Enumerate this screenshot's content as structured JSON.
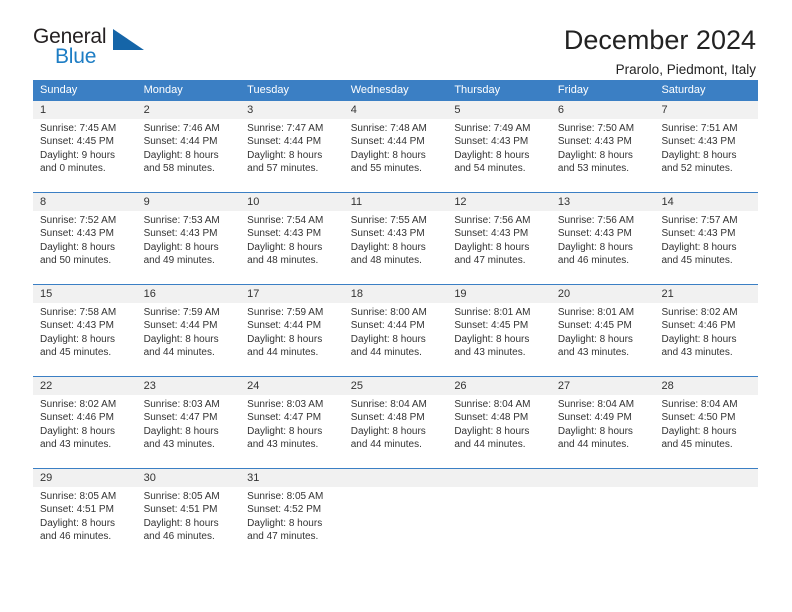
{
  "brand": {
    "name_part1": "General",
    "name_part2": "Blue",
    "triangle_color": "#1565a8",
    "blue_text_color": "#1d7dc4"
  },
  "header": {
    "title": "December 2024",
    "subtitle": "Prarolo, Piedmont, Italy"
  },
  "theme": {
    "header_blue": "#3b7fc4",
    "date_band": "#f1f1f1",
    "text": "#333333"
  },
  "weekdays": [
    "Sunday",
    "Monday",
    "Tuesday",
    "Wednesday",
    "Thursday",
    "Friday",
    "Saturday"
  ],
  "weeks": [
    {
      "days": [
        {
          "date": "1",
          "sunrise": "Sunrise: 7:45 AM",
          "sunset": "Sunset: 4:45 PM",
          "daylight1": "Daylight: 9 hours",
          "daylight2": "and 0 minutes."
        },
        {
          "date": "2",
          "sunrise": "Sunrise: 7:46 AM",
          "sunset": "Sunset: 4:44 PM",
          "daylight1": "Daylight: 8 hours",
          "daylight2": "and 58 minutes."
        },
        {
          "date": "3",
          "sunrise": "Sunrise: 7:47 AM",
          "sunset": "Sunset: 4:44 PM",
          "daylight1": "Daylight: 8 hours",
          "daylight2": "and 57 minutes."
        },
        {
          "date": "4",
          "sunrise": "Sunrise: 7:48 AM",
          "sunset": "Sunset: 4:44 PM",
          "daylight1": "Daylight: 8 hours",
          "daylight2": "and 55 minutes."
        },
        {
          "date": "5",
          "sunrise": "Sunrise: 7:49 AM",
          "sunset": "Sunset: 4:43 PM",
          "daylight1": "Daylight: 8 hours",
          "daylight2": "and 54 minutes."
        },
        {
          "date": "6",
          "sunrise": "Sunrise: 7:50 AM",
          "sunset": "Sunset: 4:43 PM",
          "daylight1": "Daylight: 8 hours",
          "daylight2": "and 53 minutes."
        },
        {
          "date": "7",
          "sunrise": "Sunrise: 7:51 AM",
          "sunset": "Sunset: 4:43 PM",
          "daylight1": "Daylight: 8 hours",
          "daylight2": "and 52 minutes."
        }
      ]
    },
    {
      "days": [
        {
          "date": "8",
          "sunrise": "Sunrise: 7:52 AM",
          "sunset": "Sunset: 4:43 PM",
          "daylight1": "Daylight: 8 hours",
          "daylight2": "and 50 minutes."
        },
        {
          "date": "9",
          "sunrise": "Sunrise: 7:53 AM",
          "sunset": "Sunset: 4:43 PM",
          "daylight1": "Daylight: 8 hours",
          "daylight2": "and 49 minutes."
        },
        {
          "date": "10",
          "sunrise": "Sunrise: 7:54 AM",
          "sunset": "Sunset: 4:43 PM",
          "daylight1": "Daylight: 8 hours",
          "daylight2": "and 48 minutes."
        },
        {
          "date": "11",
          "sunrise": "Sunrise: 7:55 AM",
          "sunset": "Sunset: 4:43 PM",
          "daylight1": "Daylight: 8 hours",
          "daylight2": "and 48 minutes."
        },
        {
          "date": "12",
          "sunrise": "Sunrise: 7:56 AM",
          "sunset": "Sunset: 4:43 PM",
          "daylight1": "Daylight: 8 hours",
          "daylight2": "and 47 minutes."
        },
        {
          "date": "13",
          "sunrise": "Sunrise: 7:56 AM",
          "sunset": "Sunset: 4:43 PM",
          "daylight1": "Daylight: 8 hours",
          "daylight2": "and 46 minutes."
        },
        {
          "date": "14",
          "sunrise": "Sunrise: 7:57 AM",
          "sunset": "Sunset: 4:43 PM",
          "daylight1": "Daylight: 8 hours",
          "daylight2": "and 45 minutes."
        }
      ]
    },
    {
      "days": [
        {
          "date": "15",
          "sunrise": "Sunrise: 7:58 AM",
          "sunset": "Sunset: 4:43 PM",
          "daylight1": "Daylight: 8 hours",
          "daylight2": "and 45 minutes."
        },
        {
          "date": "16",
          "sunrise": "Sunrise: 7:59 AM",
          "sunset": "Sunset: 4:44 PM",
          "daylight1": "Daylight: 8 hours",
          "daylight2": "and 44 minutes."
        },
        {
          "date": "17",
          "sunrise": "Sunrise: 7:59 AM",
          "sunset": "Sunset: 4:44 PM",
          "daylight1": "Daylight: 8 hours",
          "daylight2": "and 44 minutes."
        },
        {
          "date": "18",
          "sunrise": "Sunrise: 8:00 AM",
          "sunset": "Sunset: 4:44 PM",
          "daylight1": "Daylight: 8 hours",
          "daylight2": "and 44 minutes."
        },
        {
          "date": "19",
          "sunrise": "Sunrise: 8:01 AM",
          "sunset": "Sunset: 4:45 PM",
          "daylight1": "Daylight: 8 hours",
          "daylight2": "and 43 minutes."
        },
        {
          "date": "20",
          "sunrise": "Sunrise: 8:01 AM",
          "sunset": "Sunset: 4:45 PM",
          "daylight1": "Daylight: 8 hours",
          "daylight2": "and 43 minutes."
        },
        {
          "date": "21",
          "sunrise": "Sunrise: 8:02 AM",
          "sunset": "Sunset: 4:46 PM",
          "daylight1": "Daylight: 8 hours",
          "daylight2": "and 43 minutes."
        }
      ]
    },
    {
      "days": [
        {
          "date": "22",
          "sunrise": "Sunrise: 8:02 AM",
          "sunset": "Sunset: 4:46 PM",
          "daylight1": "Daylight: 8 hours",
          "daylight2": "and 43 minutes."
        },
        {
          "date": "23",
          "sunrise": "Sunrise: 8:03 AM",
          "sunset": "Sunset: 4:47 PM",
          "daylight1": "Daylight: 8 hours",
          "daylight2": "and 43 minutes."
        },
        {
          "date": "24",
          "sunrise": "Sunrise: 8:03 AM",
          "sunset": "Sunset: 4:47 PM",
          "daylight1": "Daylight: 8 hours",
          "daylight2": "and 43 minutes."
        },
        {
          "date": "25",
          "sunrise": "Sunrise: 8:04 AM",
          "sunset": "Sunset: 4:48 PM",
          "daylight1": "Daylight: 8 hours",
          "daylight2": "and 44 minutes."
        },
        {
          "date": "26",
          "sunrise": "Sunrise: 8:04 AM",
          "sunset": "Sunset: 4:48 PM",
          "daylight1": "Daylight: 8 hours",
          "daylight2": "and 44 minutes."
        },
        {
          "date": "27",
          "sunrise": "Sunrise: 8:04 AM",
          "sunset": "Sunset: 4:49 PM",
          "daylight1": "Daylight: 8 hours",
          "daylight2": "and 44 minutes."
        },
        {
          "date": "28",
          "sunrise": "Sunrise: 8:04 AM",
          "sunset": "Sunset: 4:50 PM",
          "daylight1": "Daylight: 8 hours",
          "daylight2": "and 45 minutes."
        }
      ]
    },
    {
      "days": [
        {
          "date": "29",
          "sunrise": "Sunrise: 8:05 AM",
          "sunset": "Sunset: 4:51 PM",
          "daylight1": "Daylight: 8 hours",
          "daylight2": "and 46 minutes."
        },
        {
          "date": "30",
          "sunrise": "Sunrise: 8:05 AM",
          "sunset": "Sunset: 4:51 PM",
          "daylight1": "Daylight: 8 hours",
          "daylight2": "and 46 minutes."
        },
        {
          "date": "31",
          "sunrise": "Sunrise: 8:05 AM",
          "sunset": "Sunset: 4:52 PM",
          "daylight1": "Daylight: 8 hours",
          "daylight2": "and 47 minutes."
        },
        {
          "date": "",
          "sunrise": "",
          "sunset": "",
          "daylight1": "",
          "daylight2": ""
        },
        {
          "date": "",
          "sunrise": "",
          "sunset": "",
          "daylight1": "",
          "daylight2": ""
        },
        {
          "date": "",
          "sunrise": "",
          "sunset": "",
          "daylight1": "",
          "daylight2": ""
        },
        {
          "date": "",
          "sunrise": "",
          "sunset": "",
          "daylight1": "",
          "daylight2": ""
        }
      ]
    }
  ]
}
